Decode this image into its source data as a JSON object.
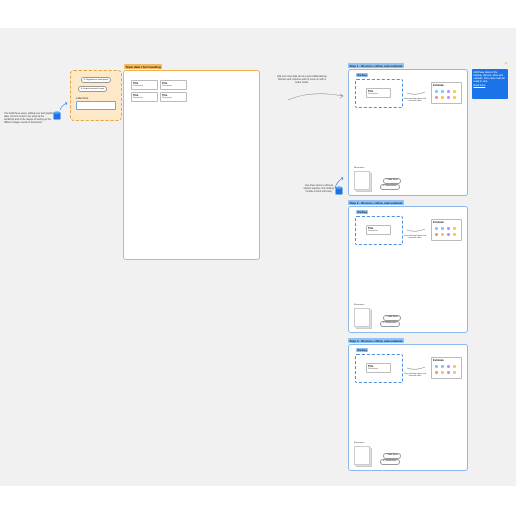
{
  "left_note": {
    "text": "You build these steps, adding new and graphic data. Current content: the steps at the workshop and at the stages of setting up the different stages needs to discussion."
  },
  "controls": {
    "btn1": "Hypothesis workspace",
    "btn2": "Import research input",
    "input_label": "Label here"
  },
  "workspace": {
    "tag": "Team data / Sort backlog",
    "cards": [
      {
        "title": "Title",
        "desc": "Description"
      },
      {
        "title": "Title",
        "desc": "Description"
      },
      {
        "title": "Title",
        "desc": "Description"
      },
      {
        "title": "Title",
        "desc": "Description"
      }
    ]
  },
  "center_note": "Add your input that can be used collaboratively. Discuss and continue work to come up with a better board.",
  "lower_note": "Use these items to discuss options together only looking. Include a short summary.",
  "steps": [
    {
      "tag": "Step 1 - Discuss, refine, and estimate",
      "group_label": "Backlog",
      "card": {
        "title": "Title",
        "desc": "Description"
      },
      "mid_note": "Drag and drop ideas and estimate effort",
      "est_label": "Estimate",
      "stack_label": "Resources",
      "btn_add": "Add Ideas",
      "btn_sum": "Summarize"
    },
    {
      "tag": "Step 2 - Discuss, refine, and estimate",
      "group_label": "Backlog",
      "card": {
        "title": "Title",
        "desc": "Description"
      },
      "mid_note": "Drag and drop ideas and estimate effort",
      "est_label": "Estimate",
      "stack_label": "Resources",
      "btn_add": "Add Ideas",
      "btn_sum": "Summarize"
    },
    {
      "tag": "Step 3 - Discuss, refine, and estimate",
      "group_label": "Backlog",
      "card": {
        "title": "Title",
        "desc": "Description"
      },
      "mid_note": "Drag and drop ideas and estimate effort",
      "est_label": "Estimate",
      "stack_label": "Resources",
      "btn_add": "Add Ideas",
      "btn_sum": "Summarize"
    }
  ],
  "sticky": {
    "text": "Add these ideas to the backlog, discuss, refine and estimate. Once done mark as ready in step.",
    "link": "Read more"
  },
  "colors": {
    "dot_row1": [
      "#7cc0f5",
      "#7cc0f5",
      "#b58df2",
      "#f5c542"
    ],
    "dot_row2": [
      "#f28b82",
      "#f5c542",
      "#b58df2",
      "#f5c542"
    ]
  },
  "icons": {
    "db": "database-icon",
    "arrow": "curved-arrow-icon",
    "star": "sparkle-icon"
  }
}
